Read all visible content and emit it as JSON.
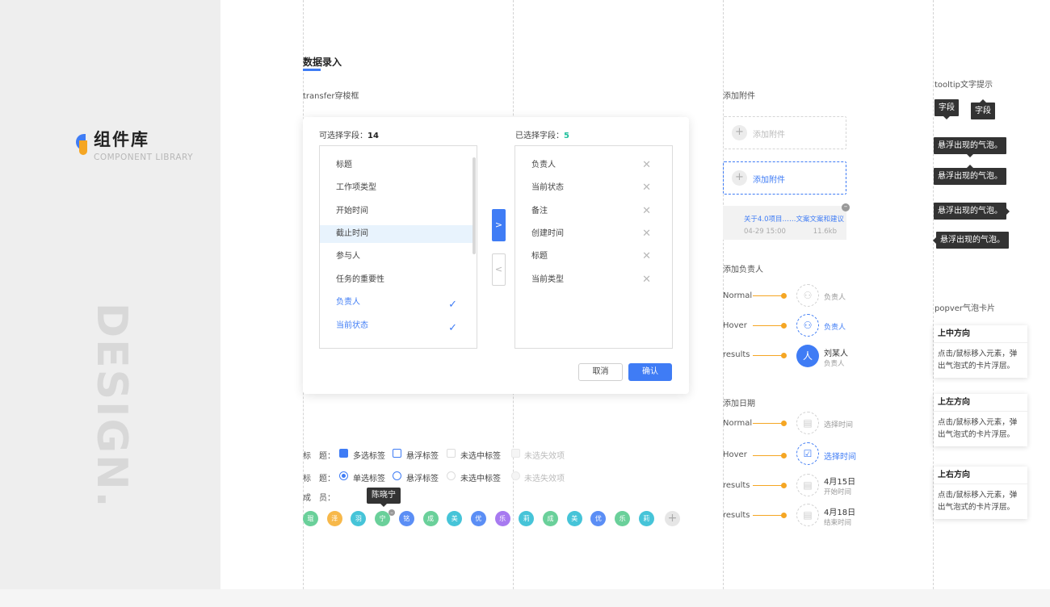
{
  "sidebar": {
    "title": "组件库",
    "subtitle": "COMPONENT LIBRARY",
    "watermark": "DESIGN."
  },
  "section": {
    "title": "数据录入",
    "transfer_label": "transfer穿梭框"
  },
  "transfer": {
    "left_header": "可选择字段：",
    "left_count": "14",
    "right_header": "已选择字段：",
    "right_count": "5",
    "left_items": [
      {
        "label": "标题"
      },
      {
        "label": "工作项类型"
      },
      {
        "label": "开始时间"
      },
      {
        "label": "截止时间"
      },
      {
        "label": "参与人"
      },
      {
        "label": "任务的重要性"
      },
      {
        "label": "负责人"
      },
      {
        "label": "当前状态"
      }
    ],
    "right_items": [
      {
        "label": "负责人"
      },
      {
        "label": "当前状态"
      },
      {
        "label": "备注"
      },
      {
        "label": "创建时间"
      },
      {
        "label": "标题"
      },
      {
        "label": "当前类型"
      }
    ],
    "move_right": ">",
    "move_left": "<",
    "cancel": "取消",
    "confirm": "确认"
  },
  "checks": {
    "row1_label": "标　题：",
    "row1": [
      "多选标签",
      "悬浮标签",
      "未选中标签",
      "未选失效项"
    ],
    "row2_label": "标　题：",
    "row2": [
      "单选标签",
      "悬浮标签",
      "未选中标签",
      "未选失效项"
    ],
    "members_label": "成　员：",
    "tooltip_name": "陈晓宁",
    "avatars": [
      {
        "t": "琨",
        "c": "#6ad09a"
      },
      {
        "t": "泽",
        "c": "#f7b84a"
      },
      {
        "t": "羽",
        "c": "#46c4d8"
      },
      {
        "t": "宁",
        "c": "#6ad09a"
      },
      {
        "t": "铭",
        "c": "#5b8ef5"
      },
      {
        "t": "成",
        "c": "#6ad09a"
      },
      {
        "t": "美",
        "c": "#46c4d8"
      },
      {
        "t": "优",
        "c": "#5b8ef5"
      },
      {
        "t": "乐",
        "c": "#a77af0"
      },
      {
        "t": "莉",
        "c": "#46c4d8"
      },
      {
        "t": "成",
        "c": "#6ad09a"
      },
      {
        "t": "美",
        "c": "#46c4d8"
      },
      {
        "t": "优",
        "c": "#5b8ef5"
      },
      {
        "t": "乐",
        "c": "#6ad09a"
      },
      {
        "t": "莉",
        "c": "#46c4d8"
      }
    ],
    "add": "+"
  },
  "attach": {
    "label": "添加附件",
    "btn": "添加附件",
    "file_name": "关于4.0项目……文案文案和建议",
    "file_date": "04-29 15:00",
    "file_size": "11.6kb"
  },
  "owner": {
    "label": "添加负责人",
    "normal": "Normal",
    "hover": "Hover",
    "results": "results",
    "placeholder": "负责人",
    "avatar_char": "人",
    "name": "刘某人",
    "role": "负责人"
  },
  "date": {
    "label": "添加日期",
    "normal": "Normal",
    "hover": "Hover",
    "results": "results",
    "placeholder": "选择时间",
    "r1_date": "4月15日",
    "r1_sub": "开始时间",
    "r2_date": "4月18日",
    "r2_sub": "结束时间"
  },
  "tooltip": {
    "label": "tooltip文字提示",
    "short": "字段",
    "long": "悬浮出现的气泡。"
  },
  "popover": {
    "label": "popver气泡卡片",
    "cards": [
      {
        "title": "上中方向",
        "body": "点击/鼠标移入元素，弹出气泡式的卡片浮层。"
      },
      {
        "title": "上左方向",
        "body": "点击/鼠标移入元素，弹出气泡式的卡片浮层。"
      },
      {
        "title": "上右方向",
        "body": "点击/鼠标移入元素，弹出气泡式的卡片浮层。"
      }
    ]
  },
  "colors": {
    "accent": "#3f7cf5",
    "orange": "#f5a623",
    "teal": "#1fbf9c"
  }
}
